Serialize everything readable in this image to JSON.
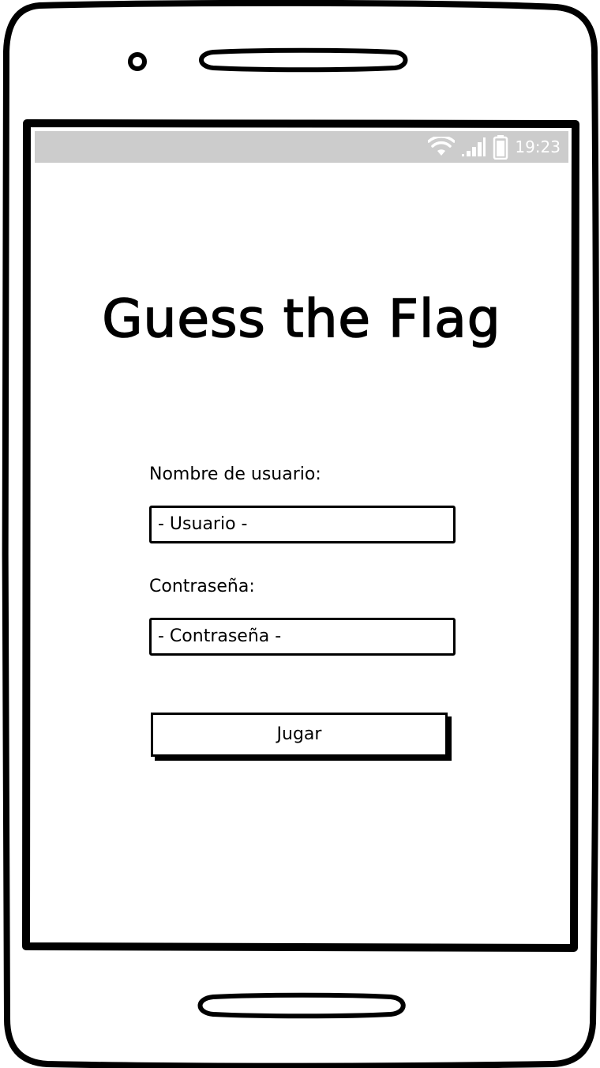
{
  "status_bar": {
    "time": "19:23",
    "icons": [
      "wifi-icon",
      "signal-icon",
      "battery-icon"
    ]
  },
  "app": {
    "title": "Guess the Flag"
  },
  "form": {
    "username_label": "Nombre de usuario:",
    "username_placeholder": "- Usuario -",
    "password_label": "Contraseña:",
    "password_placeholder": "- Contraseña -",
    "play_button_label": "Jugar"
  },
  "colors": {
    "status_bar_bg": "#cccccc",
    "status_text": "#ffffff",
    "frame": "#000000",
    "background": "#ffffff"
  }
}
